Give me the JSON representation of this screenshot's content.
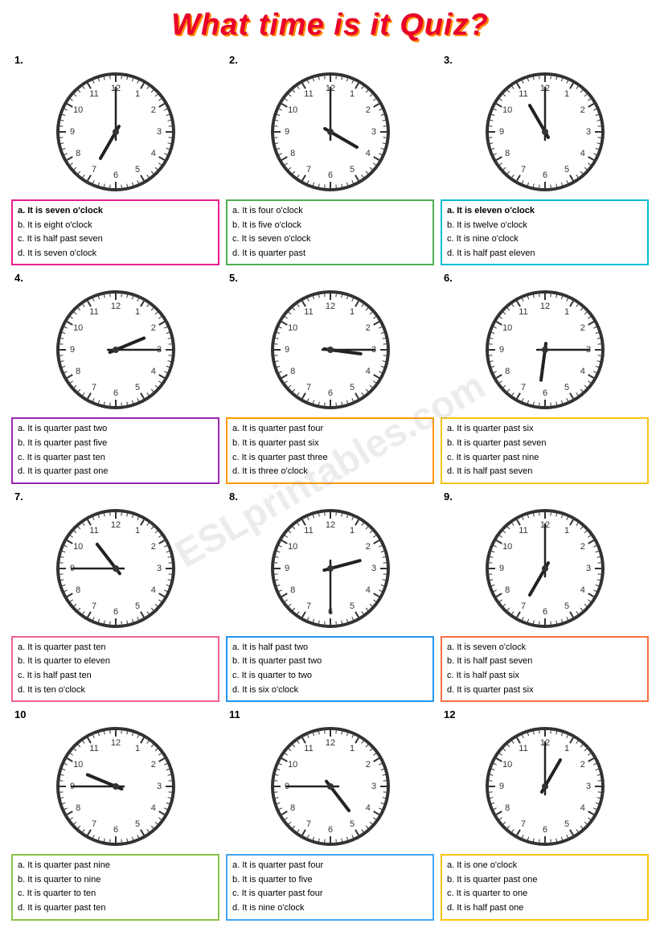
{
  "title": "What time is it Quiz?",
  "watermark": "ESLprintables.com",
  "questions": [
    {
      "number": "1.",
      "hour_angle": 210,
      "minute_angle": 90,
      "options": [
        {
          "label": "a.",
          "text": "It is seven o'clock",
          "bold": true
        },
        {
          "label": "b.",
          "text": "It is eight o'clock"
        },
        {
          "label": "c.",
          "text": "It is half past seven"
        },
        {
          "label": "d.",
          "text": "It is seven o'clock"
        }
      ],
      "border": "border-pink",
      "clock_hour": 7,
      "clock_minute": 0
    },
    {
      "number": "2.",
      "options": [
        {
          "label": "a.",
          "text": "It is four o'clock"
        },
        {
          "label": "b.",
          "text": "It is five o'clock"
        },
        {
          "label": "c.",
          "text": "It is seven o'clock"
        },
        {
          "label": "d.",
          "text": "It is quarter past"
        }
      ],
      "border": "border-green",
      "clock_hour": 4,
      "clock_minute": 0
    },
    {
      "number": "3.",
      "options": [
        {
          "label": "a.",
          "text": "It is eleven o'clock",
          "bold": true
        },
        {
          "label": "b.",
          "text": "It is twelve o'clock"
        },
        {
          "label": "c.",
          "text": "It is nine o'clock"
        },
        {
          "label": "d.",
          "text": "It is half past eleven"
        }
      ],
      "border": "border-cyan",
      "clock_hour": 11,
      "clock_minute": 0
    },
    {
      "number": "4.",
      "options": [
        {
          "label": "a.",
          "text": "It is quarter past two"
        },
        {
          "label": "b.",
          "text": "It is quarter past five"
        },
        {
          "label": "c.",
          "text": "It is quarter past ten"
        },
        {
          "label": "d.",
          "text": "It is quarter past one"
        }
      ],
      "border": "border-purple",
      "clock_hour": 2,
      "clock_minute": 15
    },
    {
      "number": "5.",
      "options": [
        {
          "label": "a.",
          "text": "It is quarter past four"
        },
        {
          "label": "b.",
          "text": "It is quarter past six"
        },
        {
          "label": "c.",
          "text": "It is quarter past three"
        },
        {
          "label": "d.",
          "text": "It is three o'clock"
        }
      ],
      "border": "border-orange",
      "clock_hour": 3,
      "clock_minute": 15
    },
    {
      "number": "6.",
      "options": [
        {
          "label": "a.",
          "text": "It is quarter past six"
        },
        {
          "label": "b.",
          "text": "It is quarter past seven"
        },
        {
          "label": "c.",
          "text": "It is quarter past nine"
        },
        {
          "label": "d.",
          "text": "It is half past seven"
        }
      ],
      "border": "border-yellow",
      "clock_hour": 6,
      "clock_minute": 15
    },
    {
      "number": "7.",
      "options": [
        {
          "label": "a.",
          "text": "It is quarter past ten"
        },
        {
          "label": "b.",
          "text": "It is quarter to eleven"
        },
        {
          "label": "c.",
          "text": "It is half past ten"
        },
        {
          "label": "d.",
          "text": "It is ten o'clock"
        }
      ],
      "border": "border-lpink",
      "clock_hour": 10,
      "clock_minute": 45
    },
    {
      "number": "8.",
      "options": [
        {
          "label": "a.",
          "text": "It is half past two"
        },
        {
          "label": "b.",
          "text": "It is quarter past two"
        },
        {
          "label": "c.",
          "text": "It is quarter to two"
        },
        {
          "label": "d.",
          "text": "It is six o'clock"
        }
      ],
      "border": "border-blue",
      "clock_hour": 2,
      "clock_minute": 30
    },
    {
      "number": "9.",
      "options": [
        {
          "label": "a.",
          "text": "It is seven o'clock"
        },
        {
          "label": "b.",
          "text": "It is half past seven"
        },
        {
          "label": "c.",
          "text": "It is half past six"
        },
        {
          "label": "d.",
          "text": "It is quarter past six"
        }
      ],
      "border": "border-lorange",
      "clock_hour": 7,
      "clock_minute": 0
    },
    {
      "number": "10",
      "options": [
        {
          "label": "a.",
          "text": "It is quarter past nine"
        },
        {
          "label": "b.",
          "text": "It is quarter to nine"
        },
        {
          "label": "c.",
          "text": "It is quarter to ten"
        },
        {
          "label": "d.",
          "text": "It is quarter past ten"
        }
      ],
      "border": "border-lgreen",
      "clock_hour": 9,
      "clock_minute": 45
    },
    {
      "number": "11",
      "options": [
        {
          "label": "a.",
          "text": "It is quarter past four"
        },
        {
          "label": "b.",
          "text": "It is quarter to five"
        },
        {
          "label": "c.",
          "text": "It is quarter past four"
        },
        {
          "label": "d.",
          "text": "It is nine o'clock"
        }
      ],
      "border": "border-lblue",
      "clock_hour": 4,
      "clock_minute": 45
    },
    {
      "number": "12",
      "options": [
        {
          "label": "a.",
          "text": "It is one o'clock"
        },
        {
          "label": "b.",
          "text": "It is quarter past one"
        },
        {
          "label": "c.",
          "text": "It is quarter to one"
        },
        {
          "label": "d.",
          "text": "It is half past one"
        }
      ],
      "border": "border-lgold",
      "clock_hour": 1,
      "clock_minute": 0
    }
  ]
}
